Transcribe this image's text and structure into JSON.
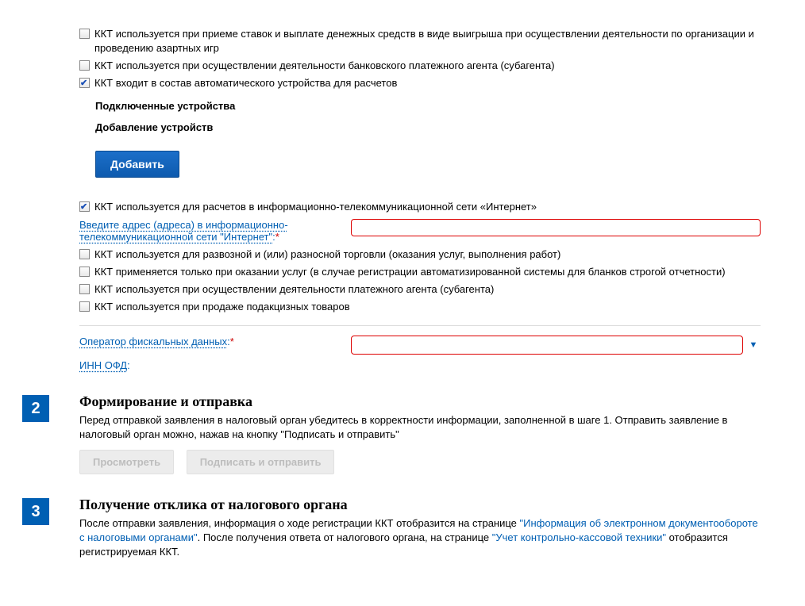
{
  "checkboxes": {
    "gambling": "ККТ используется при приеме ставок и выплате денежных средств в виде выигрыша при осуществлении деятельности по организации и проведению азартных игр",
    "bank_agent": "ККТ используется при осуществлении деятельности банковского платежного агента (субагента)",
    "auto_device": "ККТ входит в состав автоматического устройства для расчетов",
    "internet": "ККТ используется для расчетов в информационно-телекоммуникационной сети «Интернет»",
    "mobile_trade": "ККТ используется для развозной и (или) разносной торговли (оказания услуг, выполнения работ)",
    "services_only": "ККТ применяется только при оказании услуг (в случае регистрации автоматизированной системы для бланков строгой отчетности)",
    "payment_agent": "ККТ используется при осуществлении деятельности платежного агента (субагента)",
    "excise": "ККТ используется при продаже подакцизных товаров"
  },
  "sub_headings": {
    "connected": "Подключенные устройства",
    "add_devices": "Добавление устройств"
  },
  "buttons": {
    "add": "Добавить",
    "preview": "Просмотреть",
    "sign_send": "Подписать и отправить"
  },
  "fields": {
    "internet_addr_label": "Введите адрес (адреса) в информационно-телекоммуникационной сети \"Интернет\"",
    "ofd_operator_label": "Оператор фискальных данных",
    "inn_ofd_label": "ИНН ОФД",
    "colon": ":"
  },
  "step2": {
    "num": "2",
    "title": "Формирование и отправка",
    "text": "Перед отправкой заявления в налоговый орган убедитесь в корректности информации, заполненной в шаге 1. Отправить заявление в налоговый орган можно, нажав на кнопку \"Подписать и отправить\""
  },
  "step3": {
    "num": "3",
    "title": "Получение отклика от налогового органа",
    "pre": "После отправки заявления, информация о ходе регистрации ККТ отобразится на странице ",
    "link1": "\"Информация об электронном документообороте с налоговыми органами\"",
    "mid": ". После получения ответа от налогового органа, на странице ",
    "link2": "\"Учет контрольно-кассовой техники\"",
    "post": " отобразится регистрируемая ККТ."
  }
}
